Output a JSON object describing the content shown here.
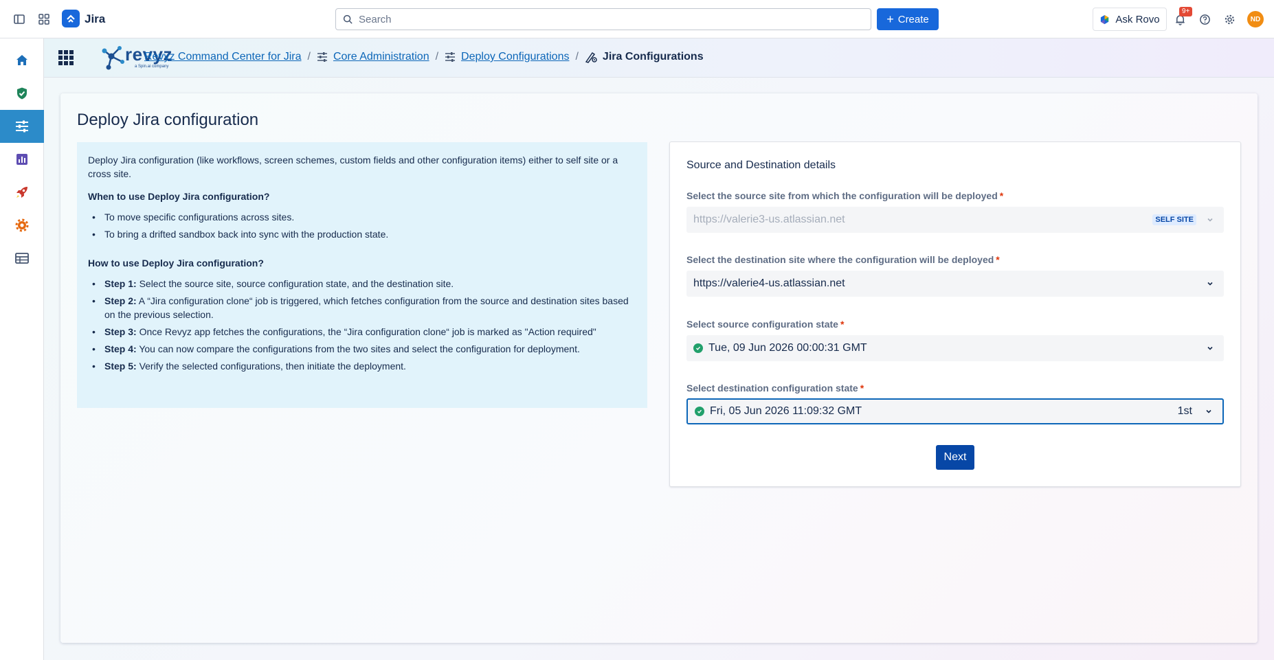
{
  "topbar": {
    "app_name": "Jira",
    "search_placeholder": "Search",
    "create_label": "Create",
    "ask_rovo_label": "Ask Rovo",
    "notifications_badge": "9+",
    "avatar_initials": "ND",
    "brand_color": "#1868db"
  },
  "rail": {
    "items": [
      "home-icon",
      "shield-check-icon",
      "sliders-icon",
      "chart-icon",
      "rocket-icon",
      "gear-icon",
      "table-icon"
    ],
    "active_index": 2
  },
  "header": {
    "logo_text": "revyz",
    "logo_subtext": "a Spin.ai company",
    "breadcrumbs": [
      {
        "label": "Revyz Command Center for Jira"
      },
      {
        "label": "Core Administration"
      },
      {
        "label": "Deploy Configurations"
      },
      {
        "label": "Jira Configurations"
      }
    ]
  },
  "page": {
    "title": "Deploy Jira configuration"
  },
  "info": {
    "intro": "Deploy Jira configuration (like workflows, screen schemes, custom fields and other configuration items) either to self site or a cross site.",
    "when_heading": "When to use Deploy Jira configuration?",
    "when_items": [
      "To move specific configurations across sites.",
      "To bring a drifted sandbox back into sync with the production state."
    ],
    "how_heading": "How to use Deploy Jira configuration?",
    "steps": [
      {
        "label": "Step 1:",
        "text": " Select the source site, source configuration state, and the destination site."
      },
      {
        "label": "Step 2:",
        "text": " A “Jira configuration clone“ job is triggered, which fetches configuration from the source and destination sites based on the previous selection."
      },
      {
        "label": "Step 3:",
        "text": " Once Revyz app fetches the configurations, the “Jira configuration clone“ job is marked as \"Action required\""
      },
      {
        "label": "Step 4:",
        "text": " You can now compare the configurations from the two sites and select the configuration for deployment."
      },
      {
        "label": "Step 5:",
        "text": " Verify the selected configurations, then initiate the deployment."
      }
    ]
  },
  "form": {
    "title": "Source and Destination details",
    "source_site": {
      "label": "Select the source site from which the configuration will be deployed",
      "value": "https://valerie3-us.atlassian.net",
      "lozenge": "SELF SITE"
    },
    "destination_site": {
      "label": "Select the destination site where the configuration will be deployed",
      "value": "https://valerie4-us.atlassian.net"
    },
    "source_state": {
      "label": "Select source configuration state",
      "value": "Tue, 09 Jun 2026 00:00:31 GMT"
    },
    "destination_state": {
      "label": "Select destination configuration state",
      "value": "Fri, 05 Jun 2026 11:09:32 GMT",
      "order": "1st"
    },
    "required_mark": "*",
    "next_label": "Next"
  }
}
